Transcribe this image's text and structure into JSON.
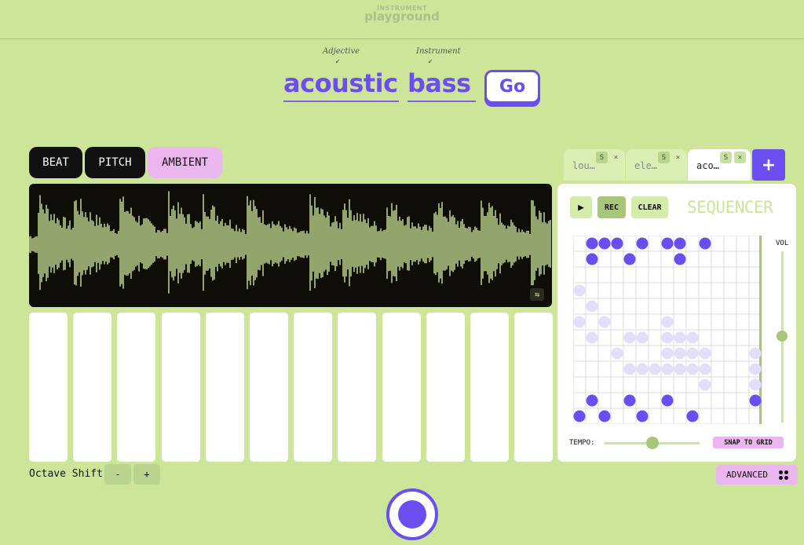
{
  "header": {
    "logo_top": "INSTRUMENT",
    "logo_bottom": "playground"
  },
  "prompt": {
    "adjective_hint": "Adjective",
    "instrument_hint": "Instrument",
    "adjective": "acoustic",
    "instrument": "bass",
    "go_label": "Go"
  },
  "modes": [
    {
      "label": "BEAT"
    },
    {
      "label": "PITCH"
    },
    {
      "label": "AMBIENT"
    }
  ],
  "controls": {
    "octave_label": "Octave Shift",
    "minus": "-",
    "plus": "+",
    "advanced_label": "ADVANCED"
  },
  "tabs": [
    {
      "label": "lou…",
      "solo": "S",
      "close": "×"
    },
    {
      "label": "ele…",
      "solo": "S",
      "close": "×"
    },
    {
      "label": "aco…",
      "solo": "S",
      "close": "×"
    }
  ],
  "add_tab": "+",
  "sequencer": {
    "title": "SEQUENCER",
    "play_glyph": "▶",
    "rec_label": "REC",
    "clear_label": "CLEAR",
    "vol_label": "VOL",
    "volume": 0.27,
    "tempo_label": "TEMPO:",
    "tempo": 0.5,
    "snap_label": "SNAP TO GRID",
    "columns": 15,
    "rows": 12,
    "notes": [
      [
        0,
        11
      ],
      [
        1,
        0
      ],
      [
        1,
        1
      ],
      [
        1,
        10
      ],
      [
        2,
        0
      ],
      [
        2,
        11
      ],
      [
        3,
        0
      ],
      [
        4,
        1
      ],
      [
        4,
        10
      ],
      [
        5,
        0
      ],
      [
        5,
        11
      ],
      [
        7,
        0
      ],
      [
        7,
        10
      ],
      [
        8,
        0
      ],
      [
        8,
        1
      ],
      [
        9,
        11
      ],
      [
        10,
        0
      ],
      [
        14,
        10
      ]
    ],
    "ghost_notes": [
      [
        0,
        3
      ],
      [
        0,
        5
      ],
      [
        1,
        4
      ],
      [
        1,
        6
      ],
      [
        2,
        5
      ],
      [
        3,
        7
      ],
      [
        4,
        6
      ],
      [
        4,
        8
      ],
      [
        5,
        6
      ],
      [
        5,
        8
      ],
      [
        6,
        8
      ],
      [
        7,
        5
      ],
      [
        7,
        6
      ],
      [
        7,
        7
      ],
      [
        7,
        8
      ],
      [
        8,
        6
      ],
      [
        8,
        7
      ],
      [
        8,
        8
      ],
      [
        9,
        6
      ],
      [
        9,
        7
      ],
      [
        9,
        8
      ],
      [
        10,
        7
      ],
      [
        10,
        8
      ],
      [
        10,
        9
      ],
      [
        14,
        7
      ],
      [
        14,
        8
      ],
      [
        14,
        9
      ]
    ]
  },
  "swap_glyph": "⇆",
  "colors": {
    "background": "#cde599",
    "accent": "#6b4ef0",
    "pink": "#ebb6ee",
    "ghost_note": "#e3defc"
  }
}
